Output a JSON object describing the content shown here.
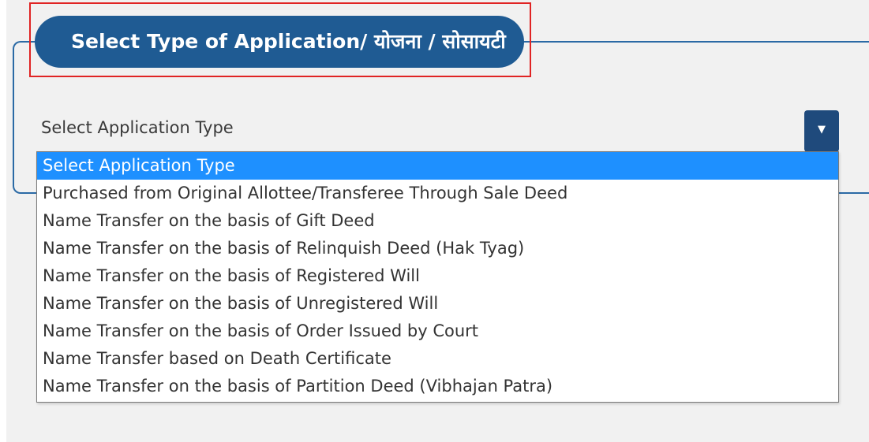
{
  "legend": {
    "title": "Select Type of Application/ योजना / सोसायटी"
  },
  "select": {
    "current_value": "Select Application Type",
    "arrow_glyph": "▼"
  },
  "dropdown": {
    "options": [
      "Select Application Type",
      "Purchased from Original Allottee/Transferee Through Sale Deed",
      "Name Transfer on the basis of Gift Deed",
      "Name Transfer on the basis of Relinquish Deed (Hak Tyag)",
      "Name Transfer on the basis of Registered Will",
      "Name Transfer on the basis of Unregistered Will",
      "Name Transfer on the basis of Order Issued by Court",
      "Name Transfer based on Death Certificate",
      "Name Transfer on the basis of Partition Deed (Vibhajan Patra)"
    ],
    "selected_index": 0
  },
  "colors": {
    "legend_bg": "#1f5b93",
    "arrow_bg": "#1f4a7c",
    "highlight_border": "#e02424",
    "option_selected_bg": "#1e90ff"
  }
}
